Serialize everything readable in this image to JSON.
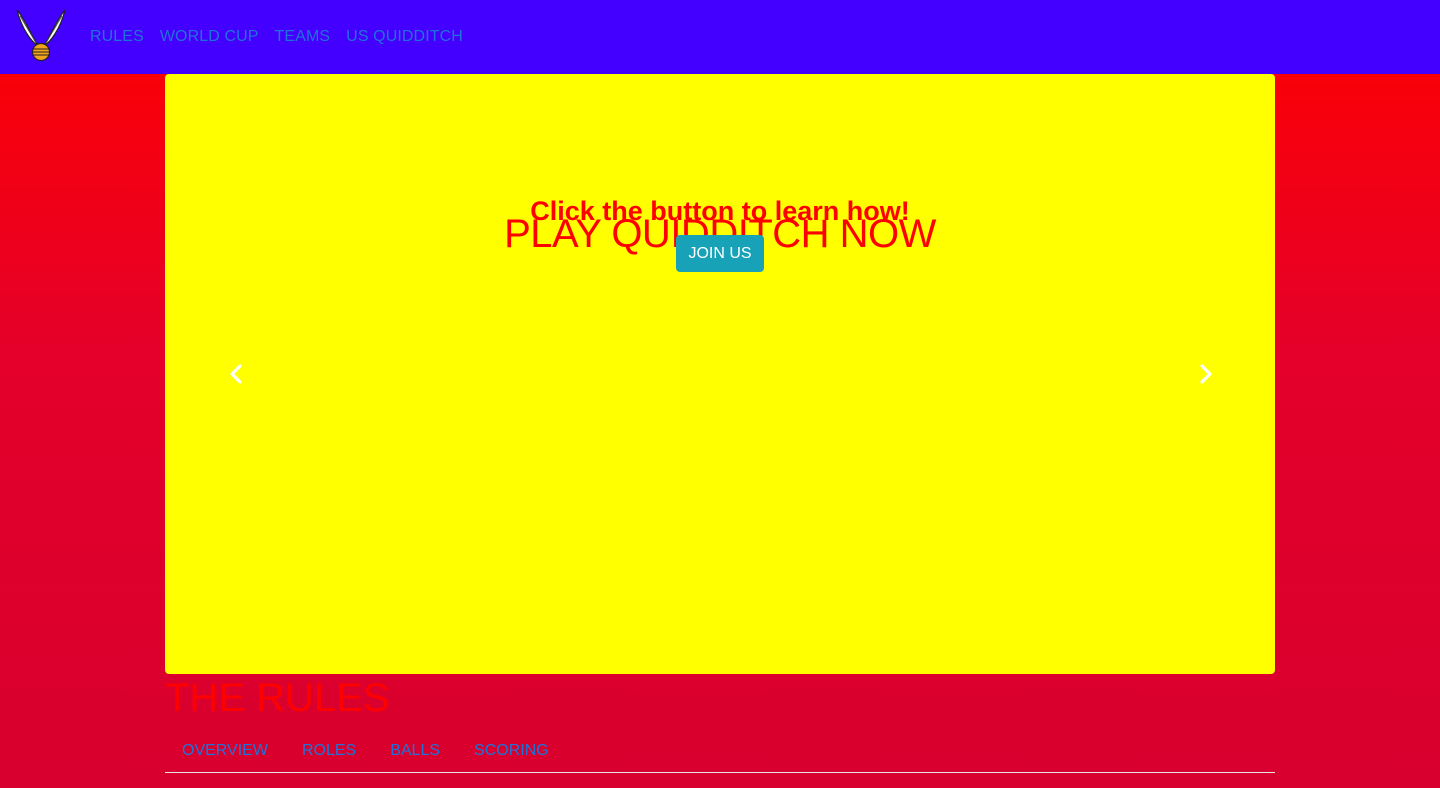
{
  "nav": {
    "logo_icon": "golden-snitch-logo-icon",
    "links": [
      "RULES",
      "WORLD CUP",
      "TEAMS",
      "US QUIDDITCH"
    ]
  },
  "carousel": {
    "title": "PLAY QUIDDITCH NOW",
    "subtitle": "Click the button to learn how!",
    "button_label": "JOIN US",
    "prev_icon": "chevron-left-icon",
    "next_icon": "chevron-right-icon"
  },
  "rules": {
    "title": "THE RULES",
    "tabs": [
      "OVERVIEW",
      "ROLES",
      "BALLS",
      "SCORING"
    ],
    "partial_heading": ""
  },
  "colors": {
    "navbar": "#4400ff",
    "link": "#1e73d9",
    "page_gradient_top": "#ff0000",
    "page_gradient_bottom": "#d8002f",
    "carousel_bg": "#ffff00",
    "heading": "#ff0000",
    "button": "#17a2b8"
  }
}
